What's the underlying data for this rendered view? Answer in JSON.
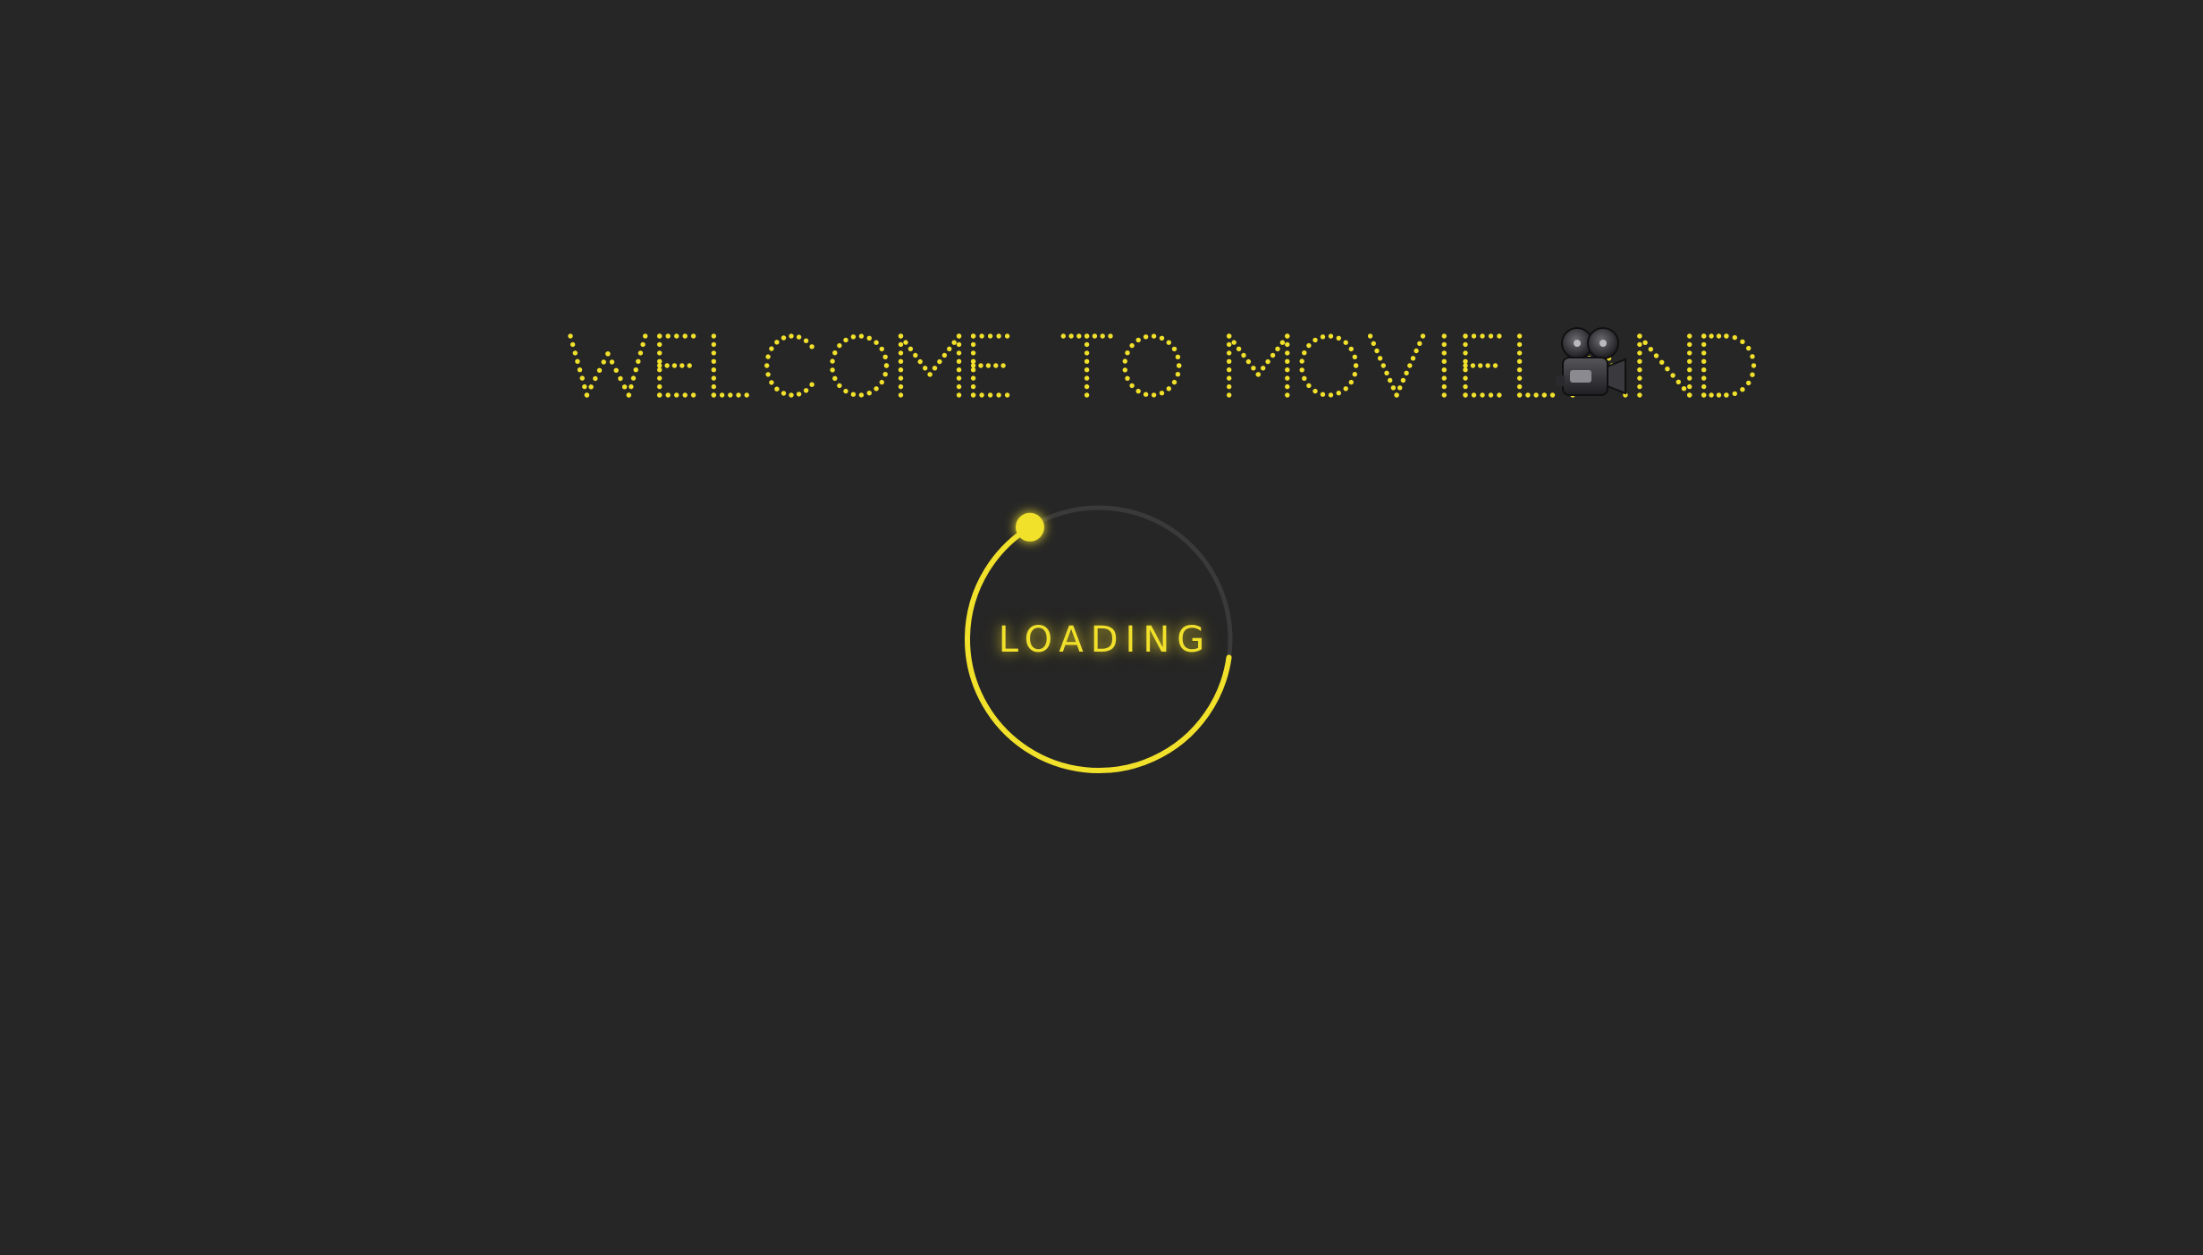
{
  "title": {
    "text": "WELCOME TO MOVIELAND",
    "icon": "movie-camera-icon"
  },
  "loader": {
    "label": "LOADING",
    "progress_fraction": 0.64
  },
  "colors": {
    "background": "#262626",
    "accent": "#f2e12b",
    "track": "#3a3a3a"
  }
}
